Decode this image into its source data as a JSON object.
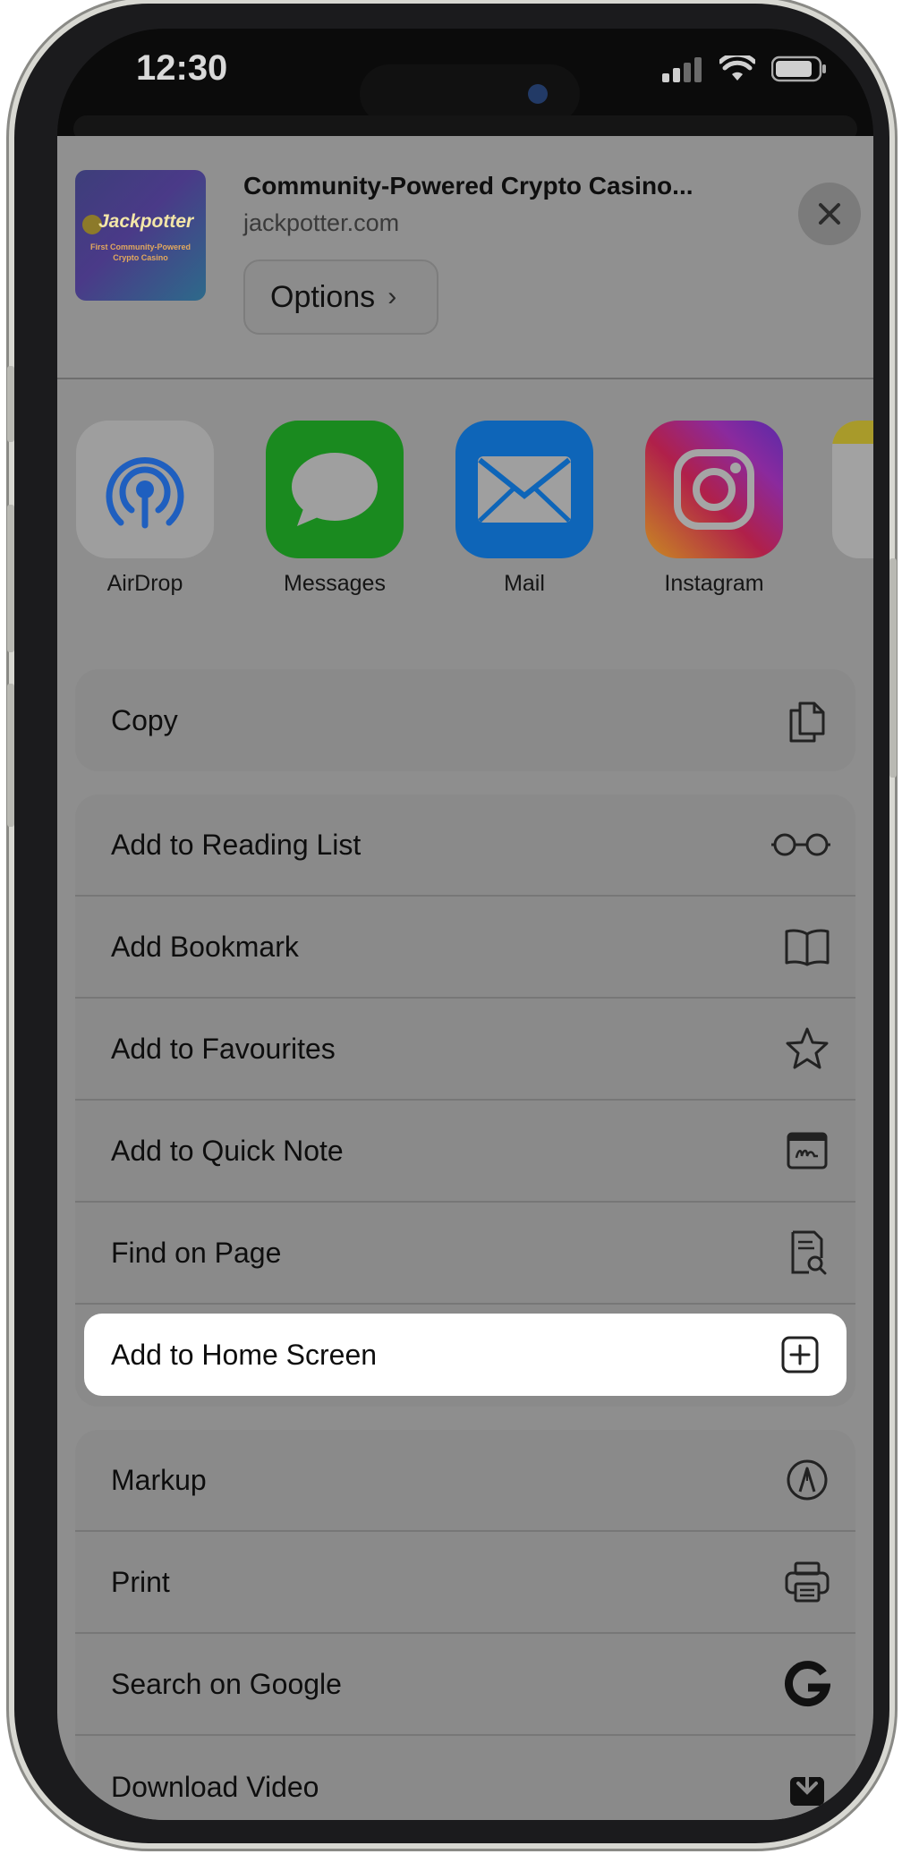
{
  "status_bar": {
    "time": "12:30"
  },
  "share_sheet": {
    "page_title": "Community-Powered Crypto Casino...",
    "page_url": "jackpotter.com",
    "options_label": "Options",
    "thumbnail": {
      "title": "Jackpotter",
      "subtitle": "First Community-Powered Crypto Casino"
    }
  },
  "apps": [
    {
      "label": "AirDrop",
      "icon": "airdrop-icon"
    },
    {
      "label": "Messages",
      "icon": "messages-icon"
    },
    {
      "label": "Mail",
      "icon": "mail-icon"
    },
    {
      "label": "Instagram",
      "icon": "instagram-icon"
    }
  ],
  "actions": {
    "copy": {
      "label": "Copy",
      "icon": "copy-icon"
    },
    "group1": [
      {
        "label": "Add to Reading List",
        "icon": "glasses-icon"
      },
      {
        "label": "Add Bookmark",
        "icon": "book-icon"
      },
      {
        "label": "Add to Favourites",
        "icon": "star-icon"
      },
      {
        "label": "Add to Quick Note",
        "icon": "quick-note-icon"
      },
      {
        "label": "Find on Page",
        "icon": "find-doc-icon"
      },
      {
        "label": "Add to Home Screen",
        "icon": "plus-square-icon",
        "highlighted": true
      }
    ],
    "group2": [
      {
        "label": "Markup",
        "icon": "markup-icon"
      },
      {
        "label": "Print",
        "icon": "printer-icon"
      },
      {
        "label": "Search on Google",
        "icon": "google-icon"
      },
      {
        "label": "Download Video",
        "icon": "download-icon"
      }
    ]
  }
}
